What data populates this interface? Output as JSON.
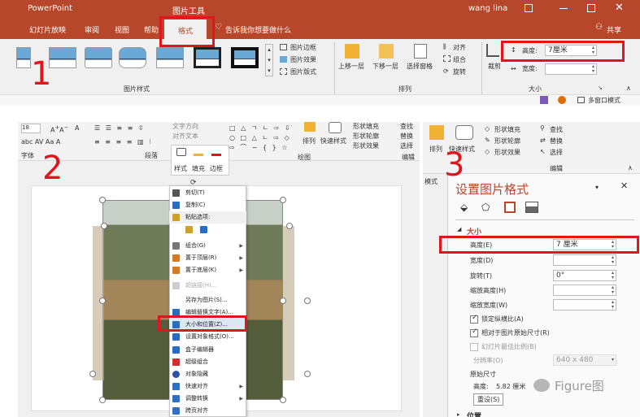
{
  "panel1": {
    "app_name": "PowerPoint",
    "context_group": "图片工具",
    "user": "wang lina",
    "tabs": [
      "幻灯片放映",
      "审阅",
      "视图",
      "帮助",
      "格式"
    ],
    "tell_me": "告诉我你想要做什么",
    "share": "共享",
    "picture_styles_group": "图片样式",
    "picture_border": "图片边框",
    "picture_effects": "图片效果",
    "picture_layout": "图片版式",
    "bring_forward": "上移一层",
    "send_backward": "下移一层",
    "selection_pane": "选择窗格",
    "align": "对齐",
    "group": "组合",
    "rotate": "旋转",
    "arrange_group": "排列",
    "crop": "裁剪",
    "height_label": "高度:",
    "height_value": "7厘米",
    "width_label": "宽度:",
    "width_value": "",
    "size_group": "大小",
    "multi_window": "多窗口模式",
    "step_number": "1"
  },
  "panel2": {
    "step_number": "2",
    "font_size": "18",
    "font_group": "字体",
    "paragraph_group": "段落",
    "drawing_group": "绘图",
    "arrange": "排列",
    "quick_styles": "快速样式",
    "shape_fill": "形状填充",
    "shape_outline": "形状轮廓",
    "shape_effects": "形状效果",
    "find": "查找",
    "replace": "替换",
    "select": "选择",
    "edit_group": "编辑",
    "text_direction": "文字方向",
    "align_text": "对齐文本",
    "mini_toolbar": [
      "样式",
      "填充",
      "边框"
    ],
    "context_menu": [
      {
        "label": "剪切(T)",
        "color": "#555555"
      },
      {
        "label": "复制(C)",
        "color": "#2a6ebb"
      },
      {
        "label": "粘贴选项:",
        "color": "#c9a227"
      },
      {
        "label": "",
        "color": ""
      },
      {
        "label": "组合(G)",
        "color": "#777777"
      },
      {
        "label": "置于顶层(R)",
        "color": "#d07a2a"
      },
      {
        "label": "置于底层(K)",
        "color": "#d07a2a"
      },
      {
        "label": "超链接(H)...",
        "color": "#aaaaaa"
      },
      {
        "label": "另存为图片(S)...",
        "color": "#ffffff"
      },
      {
        "label": "编辑替换文字(A)...",
        "color": "#2a6ebb"
      },
      {
        "label": "大小和位置(Z)...",
        "color": "#2a6ebb"
      },
      {
        "label": "设置对象格式(O)...",
        "color": "#2a6ebb"
      },
      {
        "label": "盒子编辑器",
        "color": "#2a6ebb"
      },
      {
        "label": "超级组合",
        "color": "#d03030"
      },
      {
        "label": "对象隐藏",
        "color": "#3050a0"
      },
      {
        "label": "快速对齐",
        "color": "#3070c0"
      },
      {
        "label": "调整转换",
        "color": "#3070c0"
      },
      {
        "label": "跨页对齐",
        "color": "#3070c0"
      }
    ]
  },
  "panel3": {
    "step_number": "3",
    "arrange": "排列",
    "quick_styles": "快速样式",
    "shape_fill": "形状填充",
    "shape_outline": "形状轮廓",
    "shape_effects": "形状效果",
    "find": "查找",
    "replace": "替换",
    "select": "选择",
    "edit_group": "编辑",
    "tab_label": "模式",
    "pane_title": "设置图片格式",
    "section_size": "大小",
    "height_label": "高度(E)",
    "height_value": "7 厘米",
    "width_label": "宽度(D)",
    "width_value": "",
    "rotation_label": "旋转(T)",
    "rotation_value": "0°",
    "scale_height_label": "缩放高度(H)",
    "scale_width_label": "缩放宽度(W)",
    "lock_aspect": "锁定纵横比(A)",
    "relative_original": "相对于图片原始尺寸(R)",
    "best_scale": "幻灯片最佳比例(B)",
    "resolution_label": "分辨率(O)",
    "resolution_value": "640 x 480",
    "original_size": "原始尺寸",
    "orig_height_label": "高度:",
    "orig_height_value": "5.82 厘米",
    "reset": "重设(S)",
    "position_section": "位置",
    "watermark": "Figure图"
  }
}
